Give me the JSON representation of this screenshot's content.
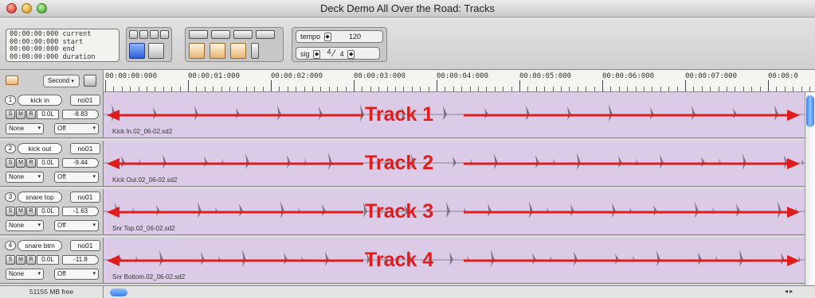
{
  "window": {
    "title": "Deck Demo All Over the Road:  Tracks"
  },
  "counter": {
    "current": "00:00:00:000 current",
    "start": "00:00:00:000 start",
    "end": "00:00:00:000 end",
    "duration": "00:00:00:000 duration"
  },
  "tempo": {
    "label": "tempo",
    "value": "120"
  },
  "sig": {
    "label": "sig",
    "numerator": "4",
    "denominator": "4"
  },
  "header_strip": {
    "time_mode": "Second"
  },
  "ruler": {
    "labels": [
      "00:00:00:000",
      "00:00:01:000",
      "00:00:02:000",
      "00:00:03:000",
      "00:00:04:000",
      "00:00:05:000",
      "00:00:06:000",
      "00:00:07:000",
      "00:00:0"
    ]
  },
  "tracks": [
    {
      "number": "1",
      "name": "kick in",
      "voice": "no01",
      "volume": "0.0L",
      "pan": "-8.83",
      "input": "None",
      "output": "Off",
      "region": "Kick In.02_06-02.sd2",
      "label": "Track 1"
    },
    {
      "number": "2",
      "name": "kick out",
      "voice": "no01",
      "volume": "0.0L",
      "pan": "-9.44",
      "input": "None",
      "output": "Off",
      "region": "Kick Out.02_06-02.sd2",
      "label": "Track 2"
    },
    {
      "number": "3",
      "name": "snare top",
      "voice": "no01",
      "volume": "0.0L",
      "pan": "-1.63",
      "input": "None",
      "output": "Off",
      "region": "Snr Top.02_06-02.sd2",
      "label": "Track 3"
    },
    {
      "number": "4",
      "name": "snare btm",
      "voice": "no01",
      "volume": "0.0L",
      "pan": "-11.8",
      "input": "None",
      "output": "Off",
      "region": "Snr Bottom.02_06-02.sd2",
      "label": "Track 4"
    }
  ],
  "status": {
    "free_space": "51155 MB free"
  },
  "colors": {
    "lane": "#dccbe6",
    "annotation": "#e01c1c",
    "scroll_thumb": "#3c7ee8"
  }
}
